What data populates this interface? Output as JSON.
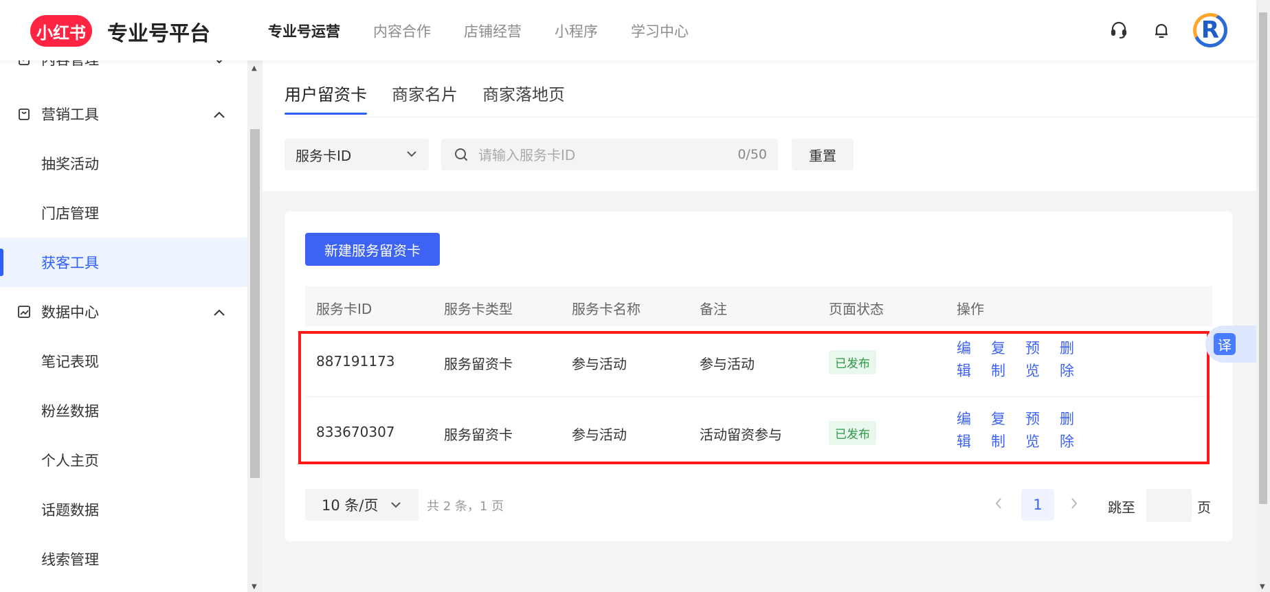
{
  "header": {
    "logo_text": "小红书",
    "brand_title": "专业号平台",
    "nav": [
      "专业号运营",
      "内容合作",
      "店铺经营",
      "小程序",
      "学习中心"
    ],
    "avatar_letter": "R"
  },
  "sidebar": {
    "groups": [
      {
        "label": "内容管理",
        "icon": "content-doc-icon"
      },
      {
        "label": "营销工具",
        "icon": "bag-icon",
        "items": [
          "抽奖活动",
          "门店管理",
          "获客工具"
        ]
      },
      {
        "label": "数据中心",
        "icon": "chart-icon",
        "items": [
          "笔记表现",
          "粉丝数据",
          "个人主页",
          "话题数据",
          "线索管理"
        ]
      }
    ],
    "active_item": "获客工具"
  },
  "tabs": [
    "用户留资卡",
    "商家名片",
    "商家落地页"
  ],
  "filter": {
    "select_value": "服务卡ID",
    "search_placeholder": "请输入服务卡ID",
    "counter": "0/50",
    "reset_label": "重置"
  },
  "table": {
    "new_button": "新建服务留资卡",
    "columns": [
      "服务卡ID",
      "服务卡类型",
      "服务卡名称",
      "备注",
      "页面状态",
      "操作"
    ],
    "rows": [
      {
        "id": "887191173",
        "type": "服务留资卡",
        "name": "参与活动",
        "note": "参与活动",
        "status": "已发布"
      },
      {
        "id": "833670307",
        "type": "服务留资卡",
        "name": "参与活动",
        "note": "活动留资参与",
        "status": "已发布"
      }
    ],
    "ops": [
      [
        "编",
        "辑"
      ],
      [
        "复",
        "制"
      ],
      [
        "预",
        "览"
      ],
      [
        "删",
        "除"
      ]
    ]
  },
  "pagination": {
    "page_size": "10 条/页",
    "info": "共 2 条，1 页",
    "current": "1",
    "jump_label": "跳至",
    "jump_unit": "页"
  },
  "translate_label": "译",
  "colors": {
    "brand_red": "#ff2442",
    "primary_blue": "#3d63f5",
    "success_green": "#2b9a47",
    "highlight_red": "#ff1a1a"
  }
}
